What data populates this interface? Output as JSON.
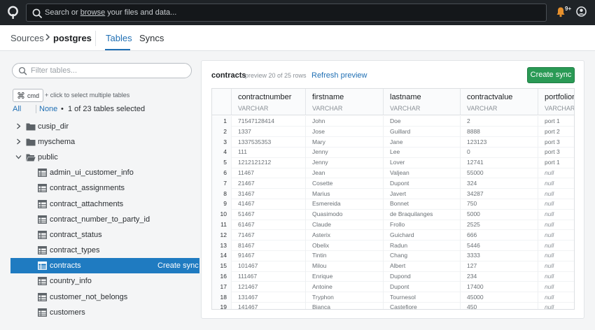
{
  "search": {
    "prefix": "Search or ",
    "link": "browse",
    "suffix": " your files and data..."
  },
  "notifications": {
    "badge": "9+"
  },
  "breadcrumb": {
    "sources": "Sources",
    "current": "postgres"
  },
  "tabs": [
    {
      "label": "Tables",
      "active": true
    },
    {
      "label": "Syncs",
      "active": false
    }
  ],
  "sidebar": {
    "filter_placeholder": "Filter tables...",
    "cmd_key": "cmd",
    "cmd_symbol": "⌘",
    "cmd_hint": "+ click to select multiple tables",
    "select_all": "All",
    "select_none": "None",
    "bullet": "•",
    "selection_count": "1 of 23 tables selected",
    "schemas": [
      {
        "label": "cusip_dir",
        "expanded": false
      },
      {
        "label": "myschema",
        "expanded": false
      },
      {
        "label": "public",
        "expanded": true
      }
    ],
    "tables": [
      "admin_ui_customer_info",
      "contract_assignments",
      "contract_attachments",
      "contract_number_to_party_id",
      "contract_status",
      "contract_types",
      "contracts",
      "country_info",
      "customer_not_belongs",
      "customers"
    ],
    "selected_table": "contracts",
    "selected_action": "Create sync"
  },
  "preview": {
    "title": "contracts",
    "subtitle": "preview 20 of 25 rows",
    "refresh": "Refresh preview",
    "create_sync": "Create sync",
    "columns": [
      {
        "name": "contractnumber",
        "type": "VARCHAR"
      },
      {
        "name": "firstname",
        "type": "VARCHAR"
      },
      {
        "name": "lastname",
        "type": "VARCHAR"
      },
      {
        "name": "contractvalue",
        "type": "VARCHAR"
      },
      {
        "name": "portfolioname",
        "type": "VARCHAR"
      }
    ],
    "rows": [
      [
        "1",
        "71547128414",
        "John",
        "Doe",
        "2",
        "port 1"
      ],
      [
        "2",
        "1337",
        "Jose",
        "Guillard",
        "8888",
        "port 2"
      ],
      [
        "3",
        "1337535353",
        "Mary",
        "Jane",
        "123123",
        "port 3"
      ],
      [
        "4",
        "111",
        "Jenny",
        "Lee",
        "0",
        "port 3"
      ],
      [
        "5",
        "1212121212",
        "Jenny",
        "Lover",
        "12741",
        "port 1"
      ],
      [
        "6",
        "11467",
        "Jean",
        "Valjean",
        "55000",
        "null"
      ],
      [
        "7",
        "21467",
        "Cosette",
        "Dupont",
        "324",
        "null"
      ],
      [
        "8",
        "31467",
        "Marius",
        "Javert",
        "34287",
        "null"
      ],
      [
        "9",
        "41467",
        "Esmereida",
        "Bonnet",
        "750",
        "null"
      ],
      [
        "10",
        "51467",
        "Quasimodo",
        "de Braquilanges",
        "5000",
        "null"
      ],
      [
        "11",
        "61467",
        "Claude",
        "Frollo",
        "2525",
        "null"
      ],
      [
        "12",
        "71467",
        "Asterix",
        "Guichard",
        "666",
        "null"
      ],
      [
        "13",
        "81467",
        "Obelix",
        "Radun",
        "5446",
        "null"
      ],
      [
        "14",
        "91467",
        "Tintin",
        "Chang",
        "3333",
        "null"
      ],
      [
        "15",
        "101467",
        "Milou",
        "Albert",
        "127",
        "null"
      ],
      [
        "16",
        "111467",
        "Enrique",
        "Dupond",
        "234",
        "null"
      ],
      [
        "17",
        "121467",
        "Antoine",
        "Dupont",
        "17400",
        "null"
      ],
      [
        "18",
        "131467",
        "Tryphon",
        "Tournesol",
        "45000",
        "null"
      ],
      [
        "19",
        "141467",
        "Bianca",
        "Castefiore",
        "450",
        "null"
      ]
    ]
  },
  "colors": {
    "accent": "#1f6fb4",
    "selected_row": "#1f7bc1",
    "create_sync_button": "#2a9a55",
    "topbar": "#1f2327",
    "bell": "#e8912d"
  }
}
